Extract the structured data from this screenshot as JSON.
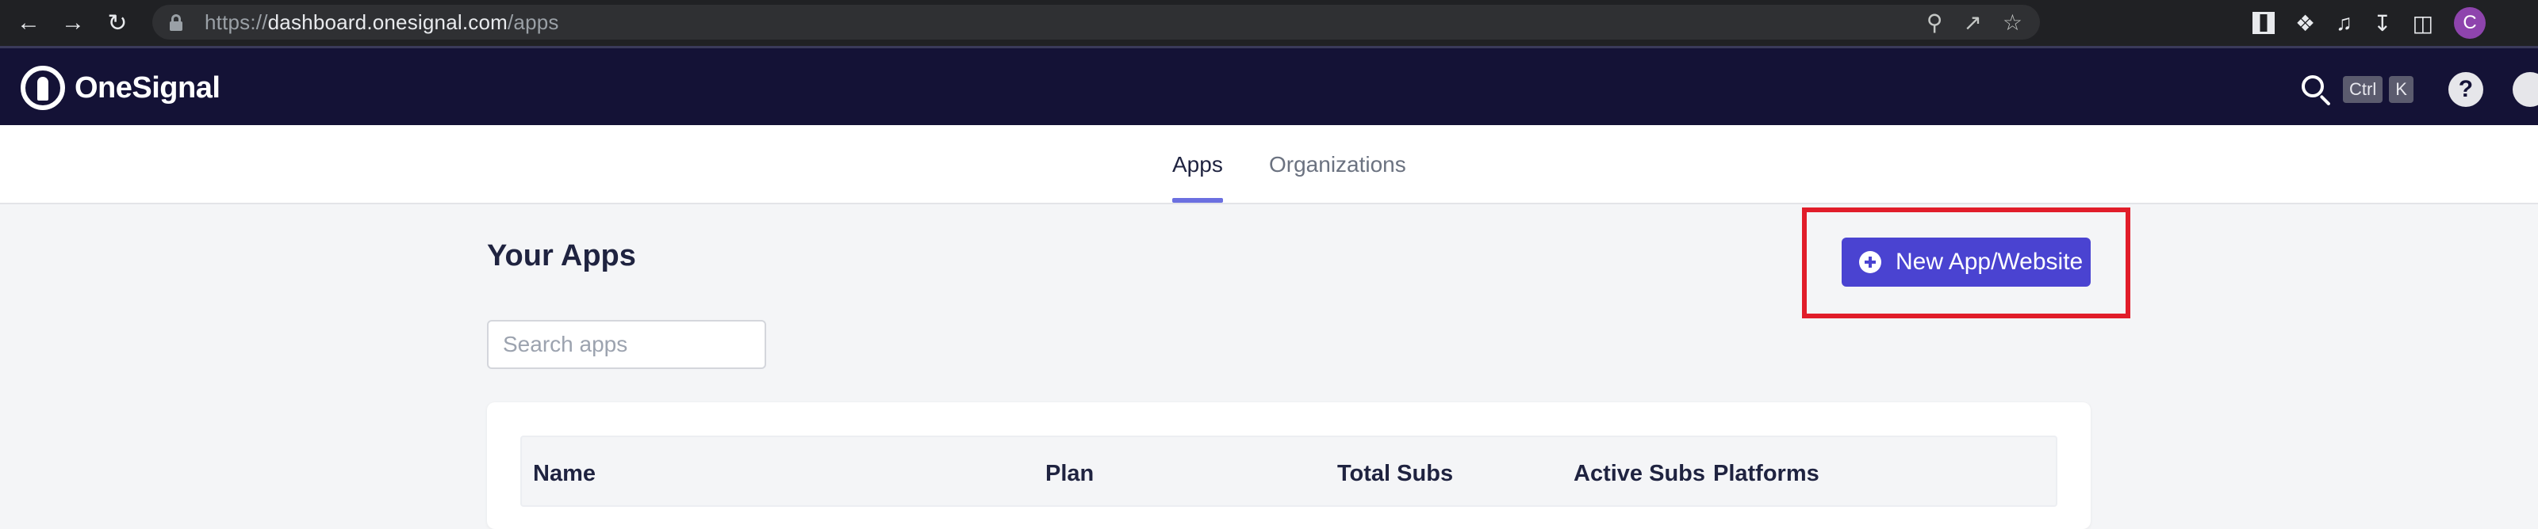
{
  "browser": {
    "url_scheme": "https://",
    "url_host": "dashboard.onesignal.com",
    "url_path": "/apps",
    "profile_initial": "C",
    "icons": [
      "back-icon",
      "forward-icon",
      "reload-icon",
      "lock-icon",
      "key-icon",
      "share-icon",
      "star-icon",
      "qr-extension-icon",
      "puzzle-icon",
      "media-icon",
      "download-icon",
      "sidepanel-icon"
    ]
  },
  "header": {
    "brand": "OneSignal",
    "kbd_ctrl": "Ctrl",
    "kbd_k": "K",
    "help_glyph": "?"
  },
  "tabs": [
    {
      "label": "Apps",
      "active": true
    },
    {
      "label": "Organizations",
      "active": false
    }
  ],
  "main": {
    "title": "Your Apps",
    "new_app_label": "New App/Website",
    "search_placeholder": "Search apps",
    "search_value": "",
    "columns": [
      "Name",
      "Plan",
      "Total Subs",
      "Active Subs",
      "Platforms"
    ]
  },
  "colors": {
    "header_bg": "#141236",
    "accent": "#4a43d1",
    "highlight": "#e11d2a",
    "tab_underline": "#6b6fe0"
  }
}
